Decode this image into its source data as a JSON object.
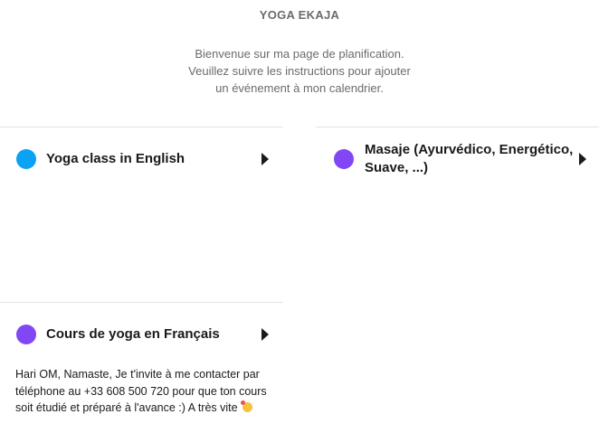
{
  "header": {
    "title": "YOGA EKAJA",
    "intro_lines": [
      "Bienvenue sur ma page de planification.",
      "Veuillez suivre les instructions pour ajouter",
      "un événement à mon calendrier."
    ]
  },
  "events": [
    {
      "name": "Yoga class in English",
      "color": "#0aa2f5",
      "icon": "play-triangle-icon"
    },
    {
      "name_lines": [
        "Masaje (Ayurvédico, Energético,",
        "Suave, ...)"
      ],
      "color": "#8247f5",
      "icon": "play-triangle-icon"
    },
    {
      "name": "Cours de yoga en Français",
      "color": "#8247f5",
      "icon": "play-triangle-icon",
      "description": "Hari OM, Namaste, Je t'invite à me contacter par téléphone au +33 608 500 720 pour que ton cours soit étudié et préparé à l'avance :) A très vite",
      "description_emoji": "smiling-face-with-hearts-icon"
    }
  ]
}
